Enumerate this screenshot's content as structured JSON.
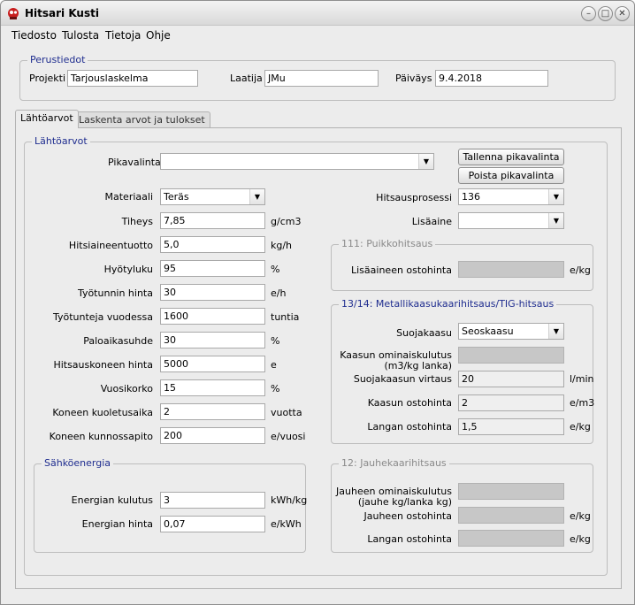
{
  "window": {
    "title": "Hitsari Kusti",
    "minimize_glyph": "–",
    "maximize_glyph": "□",
    "close_glyph": "✕",
    "app_icon": "welding-mask-icon"
  },
  "menu": [
    "Tiedosto",
    "Tulosta",
    "Tietoja",
    "Ohje"
  ],
  "perustiedot": {
    "title": "Perustiedot",
    "projekti_label": "Projekti",
    "projekti_value": "Tarjouslaskelma",
    "laatija_label": "Laatija",
    "laatija_value": "JMu",
    "paivays_label": "Päiväys",
    "paivays_value": "9.4.2018"
  },
  "tabs": [
    "Lähtöarvot",
    "Laskenta arvot ja tulokset"
  ],
  "lahtoarvot": {
    "title": "Lähtöarvot",
    "pikavalinta_label": "Pikavalinta",
    "pikavalinta_value": "",
    "save_button": "Tallenna pikavalinta",
    "delete_button": "Poista pikavalinta",
    "rows": [
      {
        "label": "Materiaali",
        "value": "Teräs",
        "unit": ""
      },
      {
        "label": "Tiheys",
        "value": "7,85",
        "unit": "g/cm3"
      },
      {
        "label": "Hitsiaineentuotto",
        "value": "5,0",
        "unit": "kg/h"
      },
      {
        "label": "Hyötyluku",
        "value": "95",
        "unit": "%"
      },
      {
        "label": "Työtunnin hinta",
        "value": "30",
        "unit": "e/h"
      },
      {
        "label": "Työtunteja vuodessa",
        "value": "1600",
        "unit": "tuntia"
      },
      {
        "label": "Paloaikasuhde",
        "value": "30",
        "unit": "%"
      },
      {
        "label": "Hitsauskoneen hinta",
        "value": "5000",
        "unit": "e"
      },
      {
        "label": "Vuosikorko",
        "value": "15",
        "unit": "%"
      },
      {
        "label": "Koneen kuoletusaika",
        "value": "2",
        "unit": "vuotta"
      },
      {
        "label": "Koneen kunnossapito",
        "value": "200",
        "unit": "e/vuosi"
      }
    ],
    "hitsausprosessi_label": "Hitsausprosessi",
    "hitsausprosessi_value": "136",
    "lisaaine_label": "Lisäaine",
    "lisaaine_value": ""
  },
  "puikko": {
    "title": "111: Puikkohitsaus",
    "lisaaine_label": "Lisäaineen ostohinta",
    "unit": "e/kg"
  },
  "mig": {
    "title": "13/14: Metallikaasukaarihitsaus/TIG-hitsaus",
    "suojakaasu_label": "Suojakaasu",
    "suojakaasu_value": "Seoskaasu",
    "kaasu_omkul_label1": "Kaasun ominaiskulutus",
    "kaasu_omkul_label2": "(m3/kg lanka)",
    "virtaus_label": "Suojakaasun virtaus",
    "virtaus_value": "20",
    "virtaus_unit": "l/min",
    "kaasu_hinta_label": "Kaasun ostohinta",
    "kaasu_hinta_value": "2",
    "kaasu_hinta_unit": "e/m3",
    "lanka_label": "Langan ostohinta",
    "lanka_value": "1,5",
    "lanka_unit": "e/kg"
  },
  "sahko": {
    "title": "Sähköenergia",
    "kulutus_label": "Energian kulutus",
    "kulutus_value": "3",
    "kulutus_unit": "kWh/kg",
    "hinta_label": "Energian hinta",
    "hinta_value": "0,07",
    "hinta_unit": "e/kWh"
  },
  "jauhe": {
    "title": "12: Jauhekaarihitsaus",
    "omkul_label1": "Jauheen ominaiskulutus",
    "omkul_label2": "(jauhe kg/lanka kg)",
    "hinta_label": "Jauheen ostohinta",
    "hinta_unit": "e/kg",
    "lanka_label": "Langan ostohinta",
    "lanka_unit": "e/kg"
  }
}
